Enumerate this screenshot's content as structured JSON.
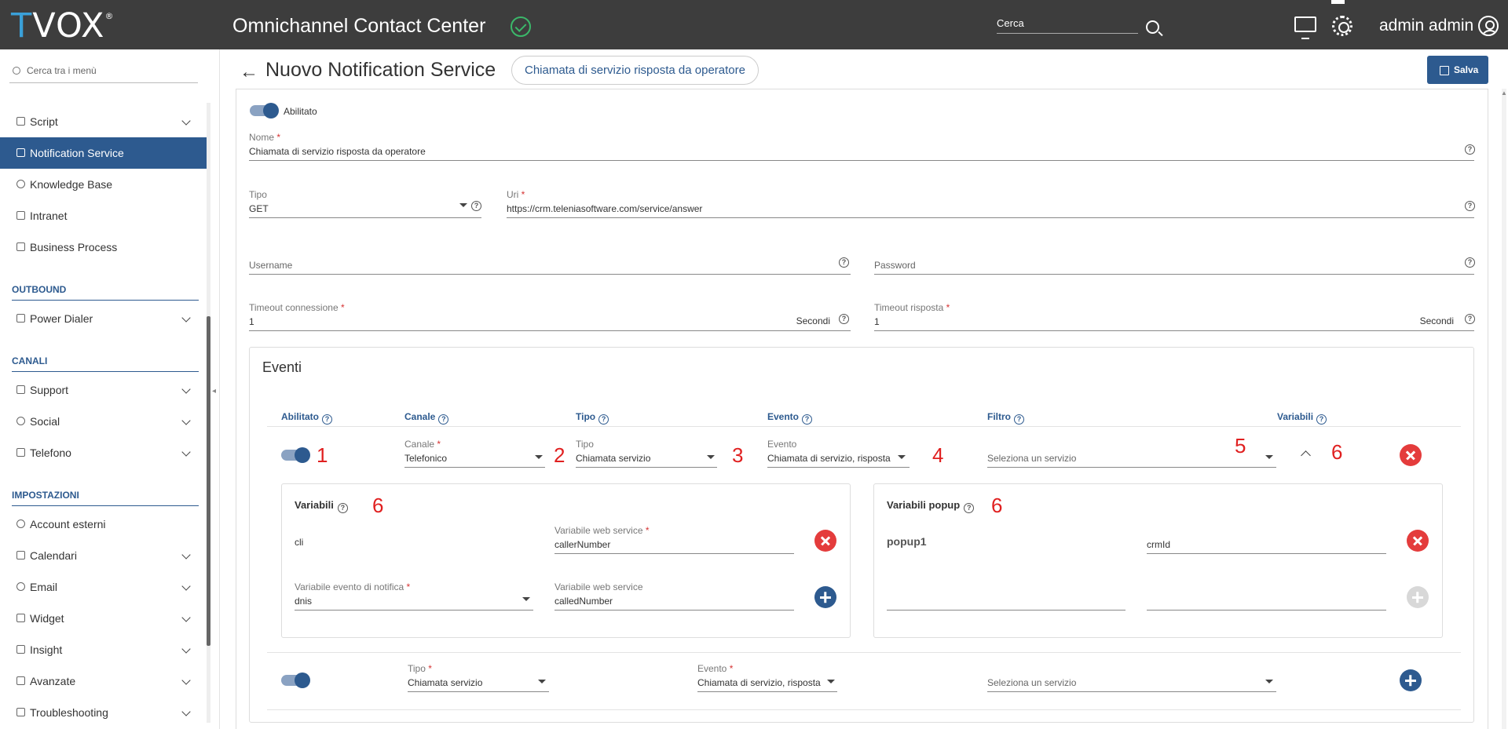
{
  "header": {
    "logo_t": "T",
    "logo_rest": "VOX",
    "logo_reg": "®",
    "app_title": "Omnichannel Contact Center",
    "search_placeholder": "Cerca",
    "user_name": "admin admin"
  },
  "sidebar": {
    "search_placeholder": "Cerca tra i menù",
    "items": [
      {
        "label": "Script",
        "icon": "code-icon",
        "expandable": true
      },
      {
        "label": "Notification Service",
        "icon": "send-icon",
        "active": true
      },
      {
        "label": "Knowledge Base",
        "icon": "info-icon"
      },
      {
        "label": "Intranet",
        "icon": "bookmark-icon"
      },
      {
        "label": "Business Process",
        "icon": "flow-icon"
      }
    ],
    "sections": [
      {
        "title": "OUTBOUND",
        "items": [
          {
            "label": "Power Dialer",
            "icon": "phone-icon",
            "expandable": true
          }
        ]
      },
      {
        "title": "CANALI",
        "items": [
          {
            "label": "Support",
            "icon": "mail-icon",
            "expandable": true
          },
          {
            "label": "Social",
            "icon": "globe-icon",
            "expandable": true
          },
          {
            "label": "Telefono",
            "icon": "phone-icon",
            "expandable": true
          }
        ]
      },
      {
        "title": "IMPOSTAZIONI",
        "items": [
          {
            "label": "Account esterni",
            "icon": "account-icon"
          },
          {
            "label": "Calendari",
            "icon": "calendar-icon",
            "expandable": true
          },
          {
            "label": "Email",
            "icon": "at-icon",
            "expandable": true
          },
          {
            "label": "Widget",
            "icon": "anchor-icon",
            "expandable": true
          },
          {
            "label": "Insight",
            "icon": "chart-icon",
            "expandable": true
          },
          {
            "label": "Avanzate",
            "icon": "gears-icon",
            "expandable": true
          },
          {
            "label": "Troubleshooting",
            "icon": "wrench-icon",
            "expandable": true
          }
        ]
      }
    ]
  },
  "page": {
    "title": "Nuovo Notification Service",
    "chip": "Chiamata di servizio risposta da operatore",
    "save_label": "Salva"
  },
  "form": {
    "enabled_label": "Abilitato",
    "nome": {
      "label": "Nome",
      "value": "Chiamata di servizio risposta da operatore"
    },
    "tipo": {
      "label": "Tipo",
      "value": "GET"
    },
    "uri": {
      "label": "Uri",
      "value": "https://crm.teleniasoftware.com/service/answer"
    },
    "username": {
      "label": "Username",
      "value": ""
    },
    "password": {
      "label": "Password",
      "value": ""
    },
    "timeout_connessione": {
      "label": "Timeout connessione",
      "value": "1",
      "unit": "Secondi"
    },
    "timeout_risposta": {
      "label": "Timeout risposta",
      "value": "1",
      "unit": "Secondi"
    }
  },
  "events": {
    "title": "Eventi",
    "columns": [
      "Abilitato",
      "Canale",
      "Tipo",
      "Evento",
      "Filtro",
      "Variabili"
    ],
    "row1": {
      "canale": {
        "label": "Canale",
        "value": "Telefonico"
      },
      "tipo": {
        "label": "Tipo",
        "value": "Chiamata servizio"
      },
      "evento": {
        "label": "Evento",
        "value": "Chiamata di servizio, risposta"
      },
      "filtro": {
        "placeholder": "Seleziona un servizio"
      }
    },
    "variabili": {
      "title": "Variabili",
      "row1": {
        "name": "cli",
        "ws_label": "Variabile web service",
        "ws_value": "callerNumber"
      },
      "row2": {
        "ev_label": "Variabile evento di notifica",
        "ev_value": "dnis",
        "ws_label": "Variabile web service",
        "ws_value": "calledNumber"
      }
    },
    "popup": {
      "title": "Variabili popup",
      "row1": {
        "name": "popup1",
        "value": "crmId"
      }
    },
    "row2": {
      "tipo": {
        "label": "Tipo",
        "value": "Chiamata servizio"
      },
      "evento": {
        "label": "Evento",
        "value": "Chiamata di servizio, risposta"
      },
      "filtro": {
        "placeholder": "Seleziona un servizio"
      }
    }
  },
  "annotations": {
    "a1": "1",
    "a2": "2",
    "a3": "3",
    "a4": "4",
    "a5": "5",
    "a6": "6"
  }
}
